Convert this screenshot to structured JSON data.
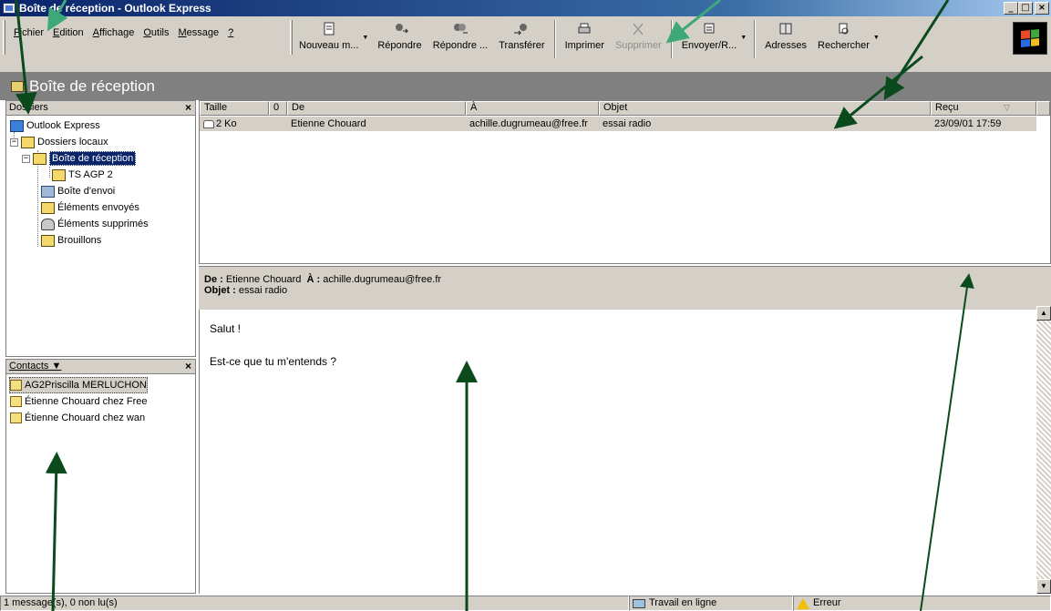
{
  "window": {
    "title": "Boîte de réception - Outlook Express",
    "min_label": "_",
    "max_label": "□",
    "close_label": "×"
  },
  "menu": [
    {
      "label": "Fichier",
      "underline": "F"
    },
    {
      "label": "Edition",
      "underline": "E"
    },
    {
      "label": "Affichage",
      "underline": "A"
    },
    {
      "label": "Outils",
      "underline": "O"
    },
    {
      "label": "Message",
      "underline": "M"
    },
    {
      "label": "?",
      "underline": "?"
    }
  ],
  "toolbar": {
    "new_label": "Nouveau m...",
    "reply_label": "Répondre",
    "reply_all_label": "Répondre ...",
    "forward_label": "Transférer",
    "print_label": "Imprimer",
    "delete_label": "Supprimer",
    "send_receive_label": "Envoyer/R...",
    "addresses_label": "Adresses",
    "find_label": "Rechercher"
  },
  "header": {
    "folder_title": "Boîte de réception"
  },
  "folders": {
    "title": "Dossiers",
    "close": "×",
    "root": "Outlook Express",
    "local": "Dossiers locaux",
    "inbox": "Boîte de réception",
    "subfolder": "TS AGP 2",
    "outbox": "Boîte d'envoi",
    "sent": "Éléments envoyés",
    "deleted": "Éléments supprimés",
    "drafts": "Brouillons"
  },
  "contacts": {
    "title": "Contacts ▼",
    "close": "×",
    "items": [
      "AG2Priscilla MERLUCHON",
      "Étienne Chouard chez Free",
      "Étienne Chouard chez wan"
    ]
  },
  "message_list": {
    "columns": [
      "Taille",
      "0",
      "De",
      "À",
      "Objet",
      "Reçu"
    ],
    "rows": [
      {
        "size": "2 Ko",
        "from": "Etienne Chouard",
        "to": "achille.dugrumeau@free.fr",
        "subject": "essai radio",
        "received": "23/09/01 17:59"
      }
    ]
  },
  "preview": {
    "from_label": "De :",
    "from": "Etienne Chouard",
    "to_label": "À :",
    "to": "achille.dugrumeau@free.fr",
    "subject_label": "Objet :",
    "subject": "essai radio",
    "body": [
      "Salut !",
      "Est-ce que tu m'entends ?"
    ]
  },
  "status": {
    "count": "1 message(s), 0 non lu(s)",
    "online": "Travail en ligne",
    "error": "Erreur"
  },
  "colors": {
    "title_gradient_start": "#0a246a",
    "title_gradient_end": "#a6caf0",
    "chrome": "#d4d0c8",
    "selection": "#0a246a",
    "annotation_dark": "#0b4a1c",
    "annotation_light": "#3fa878"
  }
}
